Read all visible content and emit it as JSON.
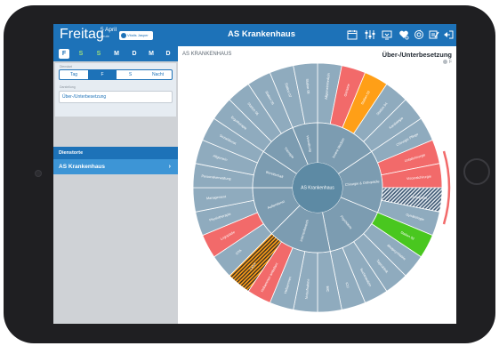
{
  "header": {
    "brand": "Freitag",
    "date_main": "5 April",
    "date_sub": "heute",
    "chip_label": "Vitalis Jasper",
    "title": "AS Krankenhaus",
    "icons": [
      "calendar-icon",
      "equalizer-icon",
      "monitor-icon",
      "heart-settings-icon",
      "refresh-icon",
      "edit-icon",
      "logout-icon"
    ]
  },
  "days": [
    {
      "label": "F",
      "selected": true,
      "color": "#ffffff"
    },
    {
      "label": "S",
      "selected": false,
      "color": "#9fe07a"
    },
    {
      "label": "S",
      "selected": false,
      "color": "#9fe07a"
    },
    {
      "label": "M",
      "selected": false,
      "color": "#ffffff"
    },
    {
      "label": "D",
      "selected": false,
      "color": "#ffffff"
    },
    {
      "label": "M",
      "selected": false,
      "color": "#ffffff"
    },
    {
      "label": "D",
      "selected": false,
      "color": "#ffffff"
    }
  ],
  "filters": {
    "shift_label": "Dienstart",
    "shifts": [
      {
        "label": "Tag",
        "selected": false
      },
      {
        "label": "F",
        "selected": true
      },
      {
        "label": "S",
        "selected": false
      },
      {
        "label": "Nacht",
        "selected": false
      }
    ],
    "view_label": "Darstellung",
    "view_value": "Über-/Unterbesetzung"
  },
  "sidebar": {
    "section_title": "Dienstorte",
    "site": "AS Krankenhaus"
  },
  "main": {
    "breadcrumb": "AS KRANKENHAUS",
    "view_title": "Über-/Unterbesetzung",
    "legend_label": "F",
    "center_label": "AS Krankenhaus"
  },
  "sunburst": {
    "center": "AS Krankenhaus",
    "inner": [
      {
        "label": "Innere Medizin",
        "span": 5
      },
      {
        "label": "Chirurgie & Orthopädie",
        "span": 5
      },
      {
        "label": "Psychiatrie",
        "span": 5
      },
      {
        "label": "Intensivbereich",
        "span": 5
      },
      {
        "label": "Außerdienst",
        "span": 4
      },
      {
        "label": "Bereitschaft",
        "span": 3
      },
      {
        "label": "Therapie",
        "span": 3
      },
      {
        "label": "Verwaltung",
        "span": 2
      }
    ],
    "outer": [
      {
        "label": "Allgemeinmedizin",
        "status": "normal"
      },
      {
        "label": "Geriatrie",
        "status": "under"
      },
      {
        "label": "Station 03",
        "status": "over"
      },
      {
        "label": "Station 04",
        "status": "normal"
      },
      {
        "label": "Kardiologie",
        "status": "normal"
      },
      {
        "label": "Chirurgie Pflege",
        "status": "normal"
      },
      {
        "label": "Unfallchirurgie",
        "status": "under"
      },
      {
        "label": "Visceralchirurgie",
        "status": "under"
      },
      {
        "label": "Orthopädie",
        "status": "hatched"
      },
      {
        "label": "Gynäkologie",
        "status": "normal"
      },
      {
        "label": "Station 02",
        "status": "good"
      },
      {
        "label": "Akutpsychiatrie",
        "status": "normal"
      },
      {
        "label": "Tagesklinik",
        "status": "normal"
      },
      {
        "label": "Suchtmedizin",
        "status": "normal"
      },
      {
        "label": "ICU",
        "status": "normal"
      },
      {
        "label": "IMC",
        "status": "normal"
      },
      {
        "label": "Notaufnahme",
        "status": "normal"
      },
      {
        "label": "Hebammen",
        "status": "normal"
      },
      {
        "label": "Hebammen ambulant",
        "status": "under"
      },
      {
        "label": "Labor",
        "status": "orange-hatched"
      },
      {
        "label": "OTA",
        "status": "normal"
      },
      {
        "label": "Logopädie",
        "status": "under"
      },
      {
        "label": "Physiotherapie",
        "status": "normal"
      },
      {
        "label": "Management",
        "status": "normal"
      },
      {
        "label": "Personalverwaltung",
        "status": "normal"
      },
      {
        "label": "Allgemein",
        "status": "normal"
      },
      {
        "label": "Sozialdienst",
        "status": "normal"
      },
      {
        "label": "Ergotherapie",
        "status": "normal"
      },
      {
        "label": "Station 05",
        "status": "normal"
      },
      {
        "label": "Station 06",
        "status": "normal"
      },
      {
        "label": "Station 07",
        "status": "normal"
      },
      {
        "label": "Station 08",
        "status": "normal"
      }
    ],
    "colors": {
      "normal": "#8fabbe",
      "inner": "#7c9cb1",
      "center": "#5d8aa4",
      "under": "#f26a6a",
      "over": "#ff9f17",
      "good": "#49c71f",
      "hatch_dark": "#3e5873",
      "hatch_orange": "#3a3023"
    }
  }
}
